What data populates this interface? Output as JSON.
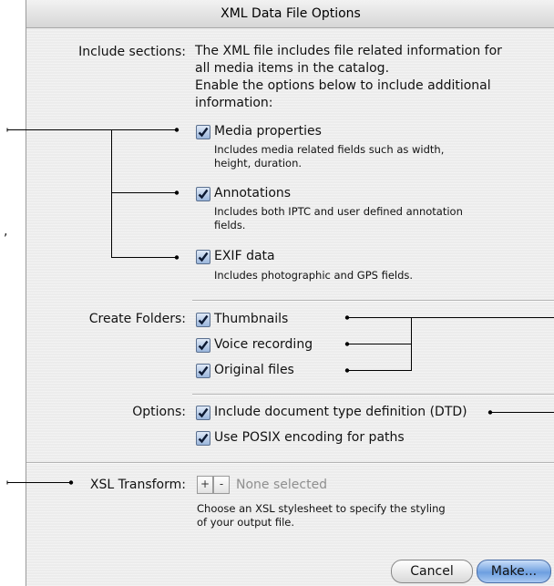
{
  "window": {
    "title": "XML Data File Options"
  },
  "include_sections": {
    "label": "Include sections:",
    "description_lines": [
      "The XML file includes file related information for",
      "all media items in the catalog.",
      "Enable the options below to include additional",
      "information:"
    ],
    "items": [
      {
        "label": "Media properties",
        "checked": true,
        "help_lines": [
          "Includes media related fields such as width,",
          "height, duration."
        ]
      },
      {
        "label": "Annotations",
        "checked": true,
        "help_lines": [
          "Includes both IPTC and user defined annotation",
          "fields."
        ]
      },
      {
        "label": "EXIF data",
        "checked": true,
        "help_lines": [
          "Includes photographic and GPS fields."
        ]
      }
    ]
  },
  "create_folders": {
    "label": "Create Folders:",
    "items": [
      {
        "label": "Thumbnails",
        "checked": true
      },
      {
        "label": "Voice recording",
        "checked": true
      },
      {
        "label": "Original files",
        "checked": true
      }
    ]
  },
  "options": {
    "label": "Options:",
    "items": [
      {
        "label": "Include document type definition (DTD)",
        "checked": true
      },
      {
        "label": "Use POSIX encoding for paths",
        "checked": true
      }
    ]
  },
  "xsl_transform": {
    "label": "XSL Transform:",
    "add_label": "+",
    "remove_label": "-",
    "value": "None selected",
    "help_lines": [
      "Choose an XSL stylesheet to specify the styling",
      "of your output file."
    ]
  },
  "buttons": {
    "cancel": "Cancel",
    "make": "Make..."
  },
  "margin_fragment": ","
}
